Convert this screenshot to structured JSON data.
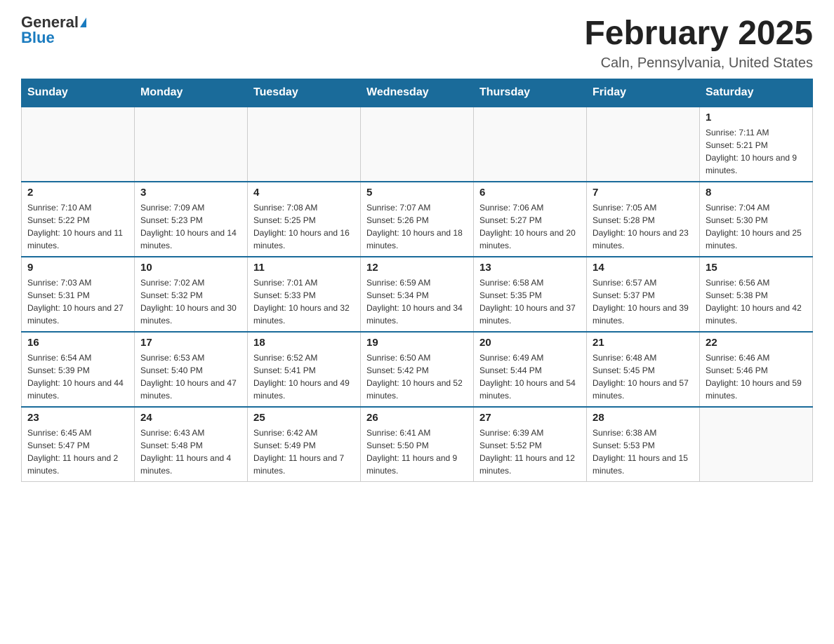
{
  "header": {
    "logo_general": "General",
    "logo_blue": "Blue",
    "title": "February 2025",
    "subtitle": "Caln, Pennsylvania, United States"
  },
  "days_of_week": [
    "Sunday",
    "Monday",
    "Tuesday",
    "Wednesday",
    "Thursday",
    "Friday",
    "Saturday"
  ],
  "weeks": [
    {
      "cells": [
        {
          "day": "",
          "empty": true
        },
        {
          "day": "",
          "empty": true
        },
        {
          "day": "",
          "empty": true
        },
        {
          "day": "",
          "empty": true
        },
        {
          "day": "",
          "empty": true
        },
        {
          "day": "",
          "empty": true
        },
        {
          "day": "1",
          "sunrise": "7:11 AM",
          "sunset": "5:21 PM",
          "daylight": "10 hours and 9 minutes."
        }
      ]
    },
    {
      "cells": [
        {
          "day": "2",
          "sunrise": "7:10 AM",
          "sunset": "5:22 PM",
          "daylight": "10 hours and 11 minutes."
        },
        {
          "day": "3",
          "sunrise": "7:09 AM",
          "sunset": "5:23 PM",
          "daylight": "10 hours and 14 minutes."
        },
        {
          "day": "4",
          "sunrise": "7:08 AM",
          "sunset": "5:25 PM",
          "daylight": "10 hours and 16 minutes."
        },
        {
          "day": "5",
          "sunrise": "7:07 AM",
          "sunset": "5:26 PM",
          "daylight": "10 hours and 18 minutes."
        },
        {
          "day": "6",
          "sunrise": "7:06 AM",
          "sunset": "5:27 PM",
          "daylight": "10 hours and 20 minutes."
        },
        {
          "day": "7",
          "sunrise": "7:05 AM",
          "sunset": "5:28 PM",
          "daylight": "10 hours and 23 minutes."
        },
        {
          "day": "8",
          "sunrise": "7:04 AM",
          "sunset": "5:30 PM",
          "daylight": "10 hours and 25 minutes."
        }
      ]
    },
    {
      "cells": [
        {
          "day": "9",
          "sunrise": "7:03 AM",
          "sunset": "5:31 PM",
          "daylight": "10 hours and 27 minutes."
        },
        {
          "day": "10",
          "sunrise": "7:02 AM",
          "sunset": "5:32 PM",
          "daylight": "10 hours and 30 minutes."
        },
        {
          "day": "11",
          "sunrise": "7:01 AM",
          "sunset": "5:33 PM",
          "daylight": "10 hours and 32 minutes."
        },
        {
          "day": "12",
          "sunrise": "6:59 AM",
          "sunset": "5:34 PM",
          "daylight": "10 hours and 34 minutes."
        },
        {
          "day": "13",
          "sunrise": "6:58 AM",
          "sunset": "5:35 PM",
          "daylight": "10 hours and 37 minutes."
        },
        {
          "day": "14",
          "sunrise": "6:57 AM",
          "sunset": "5:37 PM",
          "daylight": "10 hours and 39 minutes."
        },
        {
          "day": "15",
          "sunrise": "6:56 AM",
          "sunset": "5:38 PM",
          "daylight": "10 hours and 42 minutes."
        }
      ]
    },
    {
      "cells": [
        {
          "day": "16",
          "sunrise": "6:54 AM",
          "sunset": "5:39 PM",
          "daylight": "10 hours and 44 minutes."
        },
        {
          "day": "17",
          "sunrise": "6:53 AM",
          "sunset": "5:40 PM",
          "daylight": "10 hours and 47 minutes."
        },
        {
          "day": "18",
          "sunrise": "6:52 AM",
          "sunset": "5:41 PM",
          "daylight": "10 hours and 49 minutes."
        },
        {
          "day": "19",
          "sunrise": "6:50 AM",
          "sunset": "5:42 PM",
          "daylight": "10 hours and 52 minutes."
        },
        {
          "day": "20",
          "sunrise": "6:49 AM",
          "sunset": "5:44 PM",
          "daylight": "10 hours and 54 minutes."
        },
        {
          "day": "21",
          "sunrise": "6:48 AM",
          "sunset": "5:45 PM",
          "daylight": "10 hours and 57 minutes."
        },
        {
          "day": "22",
          "sunrise": "6:46 AM",
          "sunset": "5:46 PM",
          "daylight": "10 hours and 59 minutes."
        }
      ]
    },
    {
      "cells": [
        {
          "day": "23",
          "sunrise": "6:45 AM",
          "sunset": "5:47 PM",
          "daylight": "11 hours and 2 minutes."
        },
        {
          "day": "24",
          "sunrise": "6:43 AM",
          "sunset": "5:48 PM",
          "daylight": "11 hours and 4 minutes."
        },
        {
          "day": "25",
          "sunrise": "6:42 AM",
          "sunset": "5:49 PM",
          "daylight": "11 hours and 7 minutes."
        },
        {
          "day": "26",
          "sunrise": "6:41 AM",
          "sunset": "5:50 PM",
          "daylight": "11 hours and 9 minutes."
        },
        {
          "day": "27",
          "sunrise": "6:39 AM",
          "sunset": "5:52 PM",
          "daylight": "11 hours and 12 minutes."
        },
        {
          "day": "28",
          "sunrise": "6:38 AM",
          "sunset": "5:53 PM",
          "daylight": "11 hours and 15 minutes."
        },
        {
          "day": "",
          "empty": true
        }
      ]
    }
  ],
  "labels": {
    "sunrise_prefix": "Sunrise: ",
    "sunset_prefix": "Sunset: ",
    "daylight_prefix": "Daylight: "
  }
}
